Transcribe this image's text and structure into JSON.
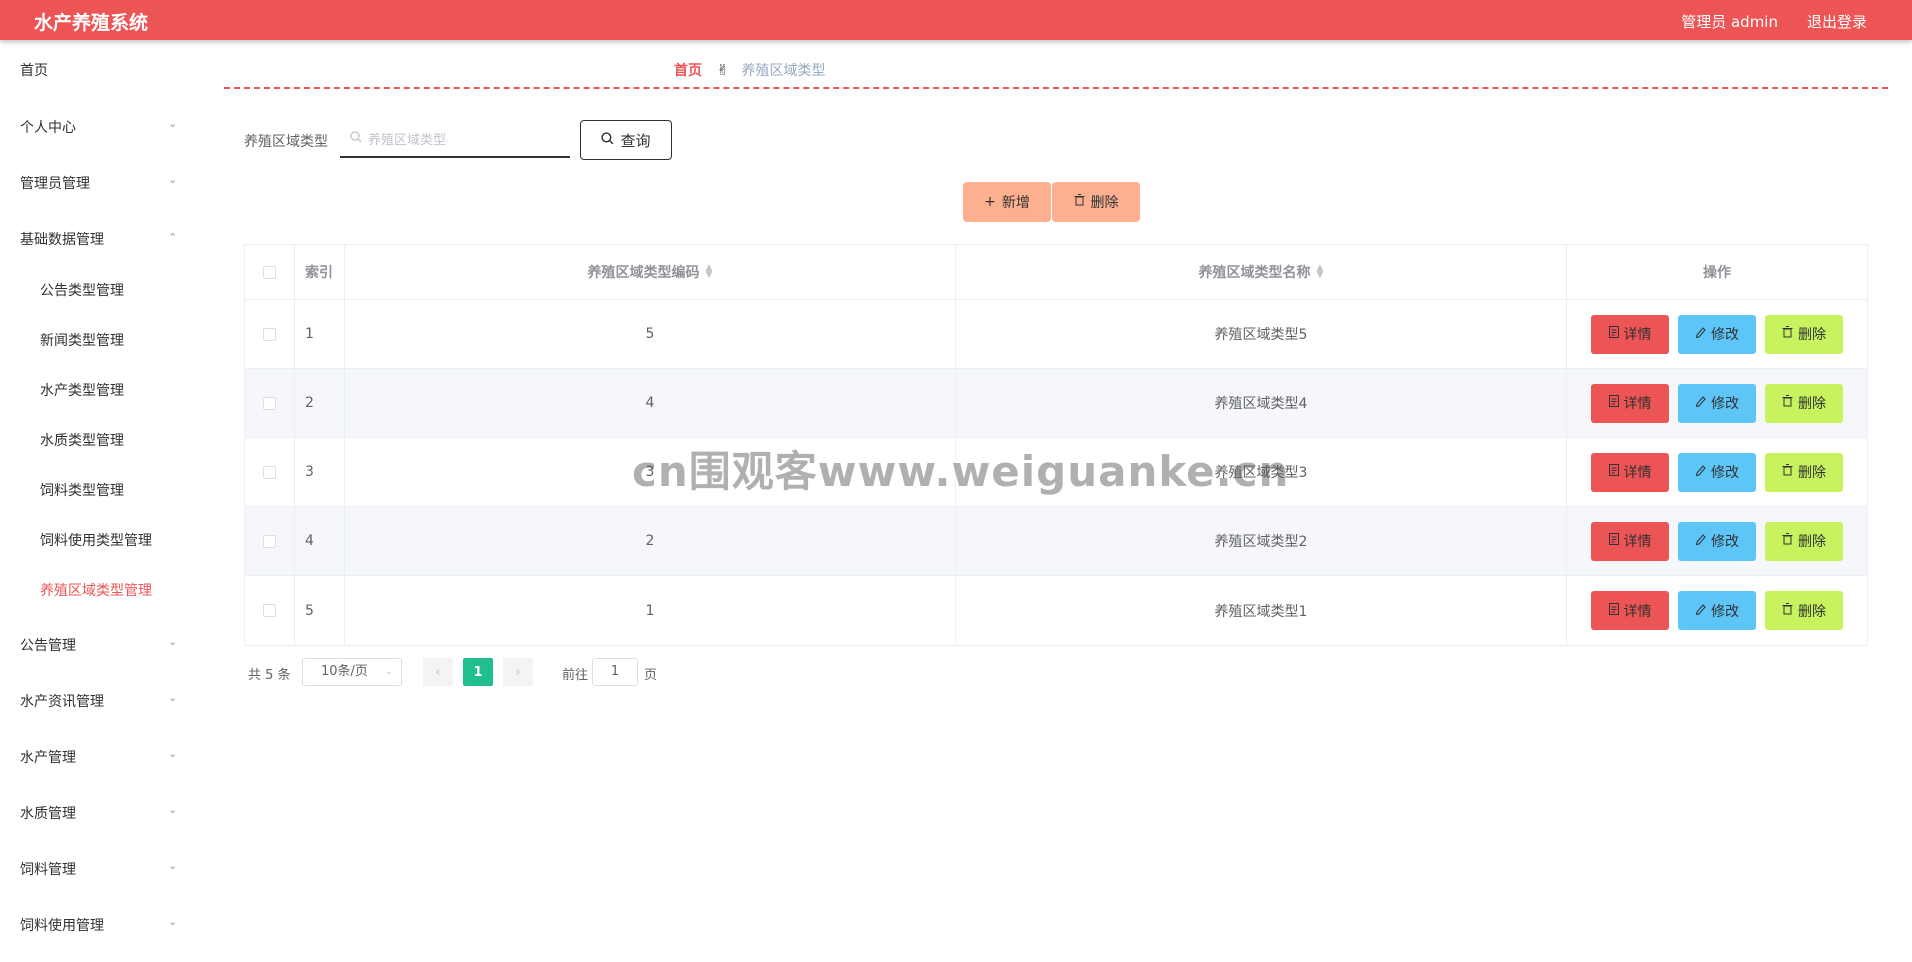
{
  "app": {
    "title": "水产养殖系统",
    "user": "管理员 admin",
    "logout": "退出登录"
  },
  "sidebar": {
    "items": [
      {
        "label": "首页"
      },
      {
        "label": "个人中心"
      },
      {
        "label": "管理员管理"
      },
      {
        "label": "基础数据管理"
      },
      {
        "label": "公告管理"
      },
      {
        "label": "水产资讯管理"
      },
      {
        "label": "水产管理"
      },
      {
        "label": "水质管理"
      },
      {
        "label": "饲料管理"
      },
      {
        "label": "饲料使用管理"
      }
    ],
    "sub_items": [
      {
        "label": "公告类型管理"
      },
      {
        "label": "新闻类型管理"
      },
      {
        "label": "水产类型管理"
      },
      {
        "label": "水质类型管理"
      },
      {
        "label": "饲料类型管理"
      },
      {
        "label": "饲料使用类型管理"
      },
      {
        "label": "养殖区域类型管理",
        "active": true
      }
    ]
  },
  "breadcrumb": {
    "home": "首页",
    "current": "养殖区域类型"
  },
  "search": {
    "label": "养殖区域类型",
    "placeholder": "养殖区域类型",
    "value": "",
    "button": "查询"
  },
  "actions": {
    "add": "新增",
    "delete": "删除"
  },
  "table": {
    "columns": {
      "index": "索引",
      "code": "养殖区域类型编码",
      "name": "养殖区域类型名称",
      "ops": "操作"
    },
    "rows": [
      {
        "index": "1",
        "code": "5",
        "name": "养殖区域类型5"
      },
      {
        "index": "2",
        "code": "4",
        "name": "养殖区域类型4"
      },
      {
        "index": "3",
        "code": "3",
        "name": "养殖区域类型3"
      },
      {
        "index": "4",
        "code": "2",
        "name": "养殖区域类型2"
      },
      {
        "index": "5",
        "code": "1",
        "name": "养殖区域类型1"
      }
    ],
    "row_buttons": {
      "detail": "详情",
      "edit": "修改",
      "delete": "删除"
    }
  },
  "pagination": {
    "total": "共 5 条",
    "page_size": "10条/页",
    "current_page": "1",
    "goto_label": "前往",
    "goto_value": "1",
    "page_suffix": "页"
  },
  "watermark": "cn围观客www.weiguanke.cn",
  "colors": {
    "primary": "#ec5456",
    "accent_orange": "#fcb08f",
    "detail_btn": "#ec5456",
    "edit_btn": "#5ec5f7",
    "delete_btn": "#c9f35e",
    "page_active": "#1fbf8f"
  }
}
